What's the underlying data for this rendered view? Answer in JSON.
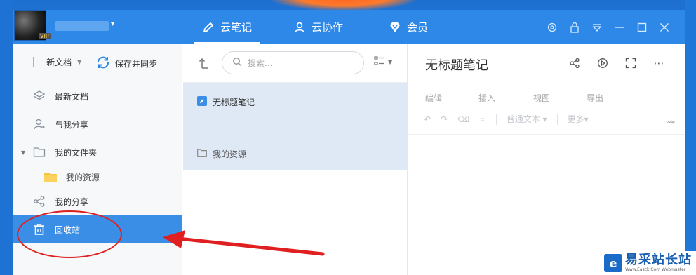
{
  "header": {
    "vip_badge": "VIP",
    "tabs": [
      {
        "label": "云笔记",
        "icon": "pencil-icon",
        "active": true
      },
      {
        "label": "云协作",
        "icon": "person-icon",
        "active": false
      },
      {
        "label": "会员",
        "icon": "diamond-icon",
        "active": false
      }
    ],
    "controls": [
      "settings-icon",
      "lock-icon",
      "dropdown-icon",
      "minimize-icon",
      "maximize-icon",
      "close-icon"
    ]
  },
  "sidebar": {
    "new_doc_label": "新文档",
    "save_sync_label": "保存并同步",
    "items": [
      {
        "label": "最新文档",
        "icon": "layers-icon"
      },
      {
        "label": "与我分享",
        "icon": "shared-user-icon"
      },
      {
        "label": "我的文件夹",
        "icon": "folder-outline-icon"
      },
      {
        "label": "我的资源",
        "icon": "folder-yellow-icon"
      },
      {
        "label": "我的分享",
        "icon": "share-icon"
      },
      {
        "label": "回收站",
        "icon": "trash-icon",
        "active": true
      }
    ]
  },
  "list": {
    "search_placeholder": "搜索...",
    "notes": [
      {
        "title": "无标题笔记",
        "icon": "note-icon"
      }
    ],
    "folders": [
      {
        "title": "我的资源",
        "icon": "folder-icon"
      }
    ]
  },
  "editor": {
    "title": "无标题笔记",
    "menu": [
      "编辑",
      "插入",
      "视图",
      "导出"
    ],
    "text_style": "普通文本",
    "more_label": "更多"
  },
  "watermark": {
    "main": "易采站长站",
    "sub": "Www.Easck.Com  Webmaster"
  },
  "colors": {
    "accent": "#2e88e8",
    "active_row": "#3a8ee6",
    "annotation": "#e02020"
  }
}
